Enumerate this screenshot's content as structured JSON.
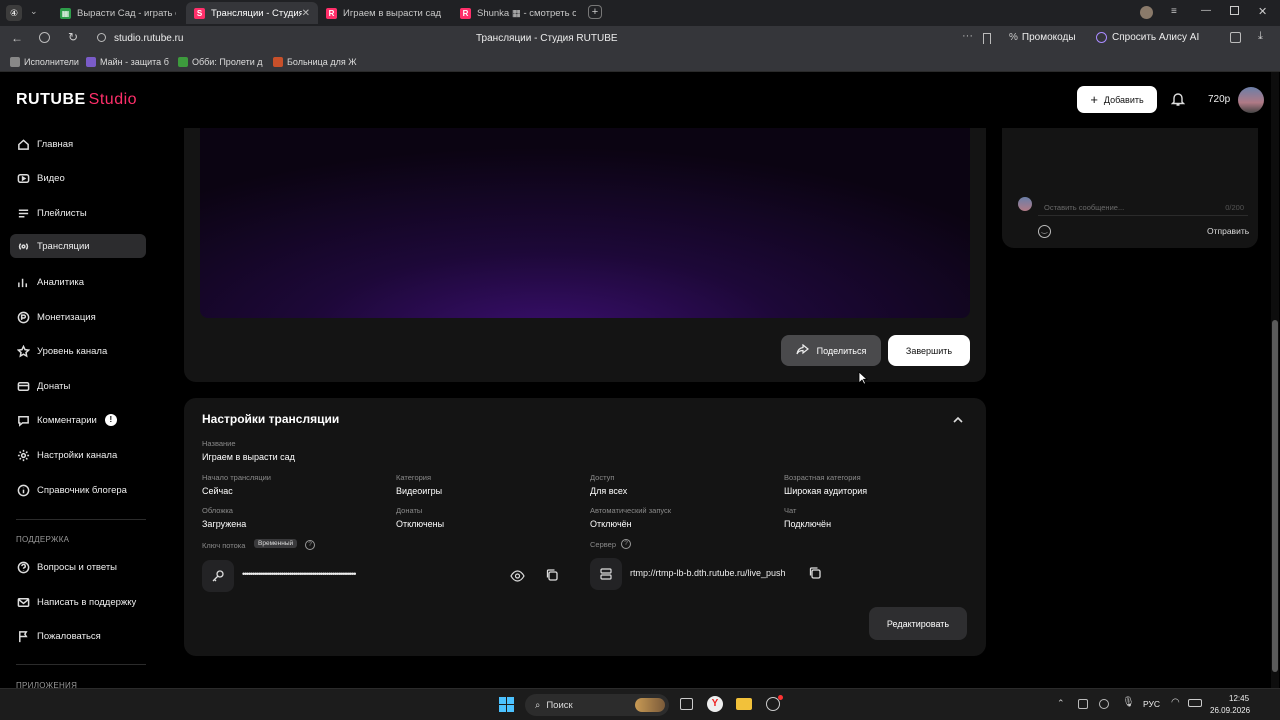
{
  "browser": {
    "tabs": [
      {
        "title": "Вырасти Сад - играть он",
        "fav_color": "#2e9d4a",
        "fav_glyph": "▦"
      },
      {
        "title": "Трансляции - Студия R",
        "fav_color": "#ff2f6a",
        "fav_glyph": "S"
      },
      {
        "title": "Играем в вырасти сад",
        "fav_color": "#ff2f6a",
        "fav_glyph": "R"
      },
      {
        "title": "Shunka ▦ - смотреть он",
        "fav_color": "#ff2f6a",
        "fav_glyph": "R"
      }
    ],
    "url": "studio.rutube.ru",
    "page_title": "Трансляции - Студия RUTUBE",
    "promo_label": "Промокоды",
    "alice_label": "Спросить Алису AI",
    "bookmarks": [
      {
        "label": "Исполнители",
        "color": "#888"
      },
      {
        "label": "Майн - защита б",
        "color": "#7a5cc9"
      },
      {
        "label": "Обби: Пролети д",
        "color": "#3d9b3d"
      },
      {
        "label": "Больница для Ж",
        "color": "#c8502a"
      }
    ]
  },
  "header": {
    "logo_main": "RUTUBE",
    "logo_sub": "Studio",
    "add_label": "Добавить",
    "quality_label": "720p"
  },
  "sidebar": {
    "items": [
      {
        "label": "Главная",
        "icon": "home-icon"
      },
      {
        "label": "Видео",
        "icon": "video-icon"
      },
      {
        "label": "Плейлисты",
        "icon": "playlist-icon"
      },
      {
        "label": "Трансляции",
        "icon": "broadcast-icon"
      },
      {
        "label": "Аналитика",
        "icon": "analytics-icon"
      },
      {
        "label": "Монетизация",
        "icon": "monetization-icon"
      },
      {
        "label": "Уровень канала",
        "icon": "star-icon"
      },
      {
        "label": "Донаты",
        "icon": "donate-icon"
      },
      {
        "label": "Комментарии",
        "icon": "comment-icon"
      },
      {
        "label": "Настройки канала",
        "icon": "gear-icon"
      },
      {
        "label": "Справочник блогера",
        "icon": "info-icon"
      }
    ],
    "support_heading": "ПОДДЕРЖКА",
    "support_items": [
      {
        "label": "Вопросы и ответы",
        "icon": "help-icon"
      },
      {
        "label": "Написать в поддержку",
        "icon": "mail-icon"
      },
      {
        "label": "Пожаловаться",
        "icon": "flag-icon"
      }
    ],
    "apps_heading": "ПРИЛОЖЕНИЯ",
    "comments_badge": "!"
  },
  "player": {
    "share_label": "Поделиться",
    "finish_label": "Завершить"
  },
  "chat": {
    "placeholder": "Оставить сообщение...",
    "counter": "0/200",
    "send_label": "Отправить"
  },
  "settings": {
    "title": "Настройки трансляции",
    "name_label": "Название",
    "name_value": "Играем в вырасти сад",
    "fields": [
      {
        "label": "Начало трансляции",
        "value": "Сейчас"
      },
      {
        "label": "Категория",
        "value": "Видеоигры"
      },
      {
        "label": "Доступ",
        "value": "Для всех"
      },
      {
        "label": "Возрастная категория",
        "value": "Широкая аудитория"
      },
      {
        "label": "Обложка",
        "value": "Загружена"
      },
      {
        "label": "Донаты",
        "value": "Отключены"
      },
      {
        "label": "Автоматический запуск",
        "value": "Отключён"
      },
      {
        "label": "Чат",
        "value": "Подключён"
      }
    ],
    "stream_key_label": "Ключ потока",
    "stream_key_badge": "Временный",
    "stream_key_value": "••••••••••••••••••••••••••••••••••••••••••••••••••••••••••",
    "server_label": "Сервер",
    "server_value": "rtmp://rtmp-lb-b.dth.rutube.ru/live_push",
    "edit_label": "Редактировать"
  },
  "taskbar": {
    "search_label": "Поиск",
    "lang": "РУС",
    "time": "12:45",
    "date": "26.09.2026"
  }
}
